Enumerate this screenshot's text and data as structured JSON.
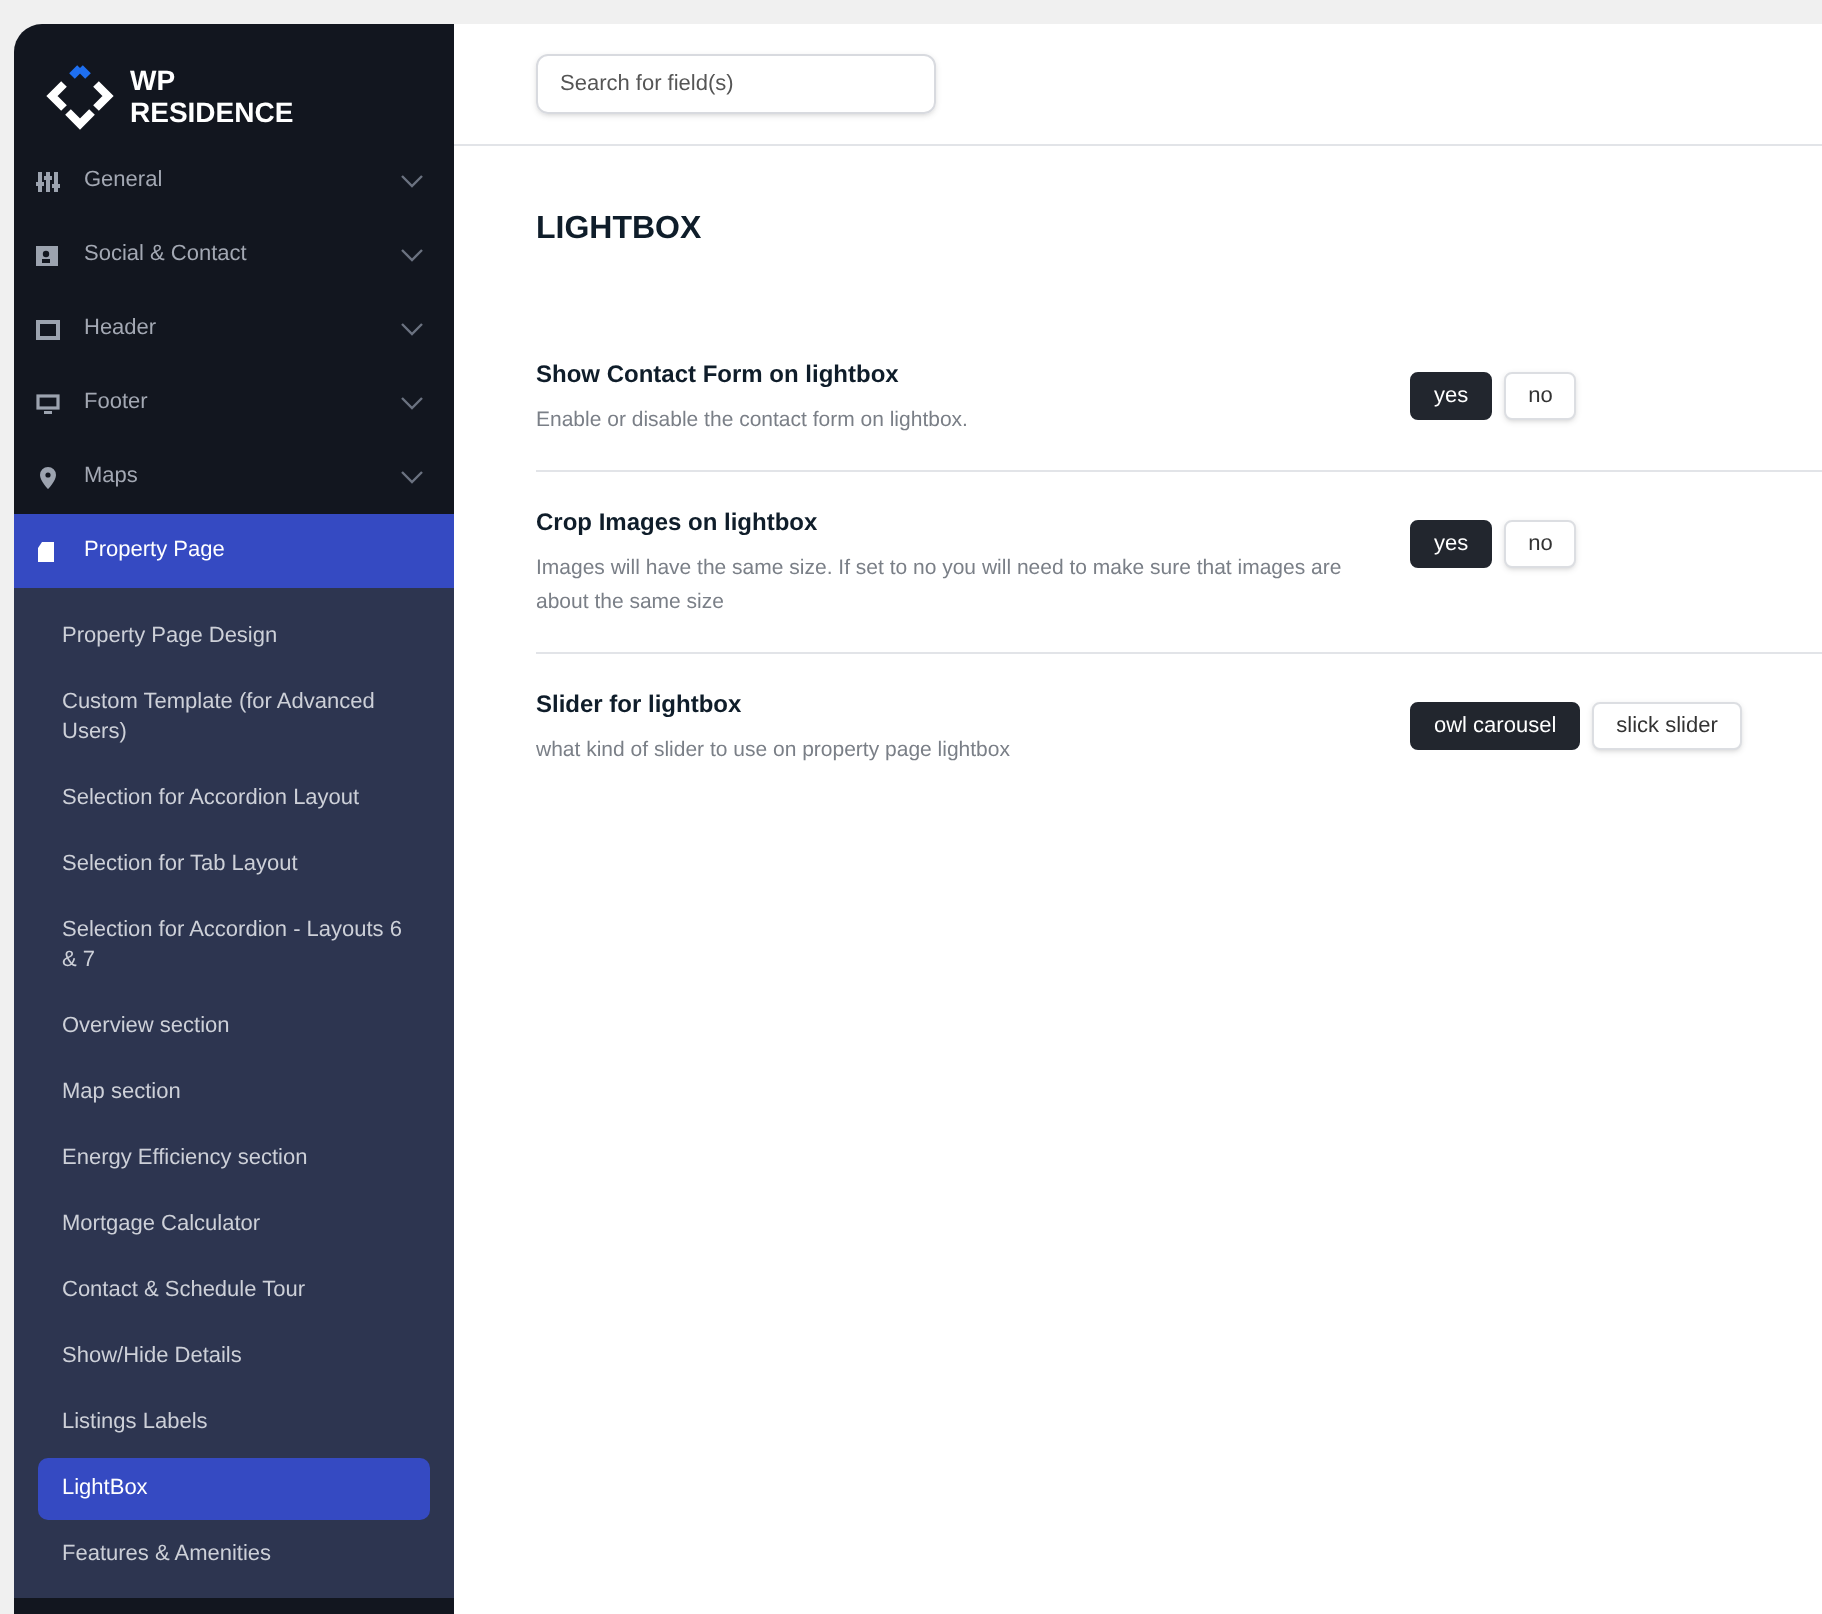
{
  "logo": {
    "lines": [
      "WP",
      "RESIDENCE"
    ]
  },
  "sidebar": {
    "items": [
      {
        "label": "General",
        "selected": false,
        "expanded": false
      },
      {
        "label": "Social & Contact",
        "selected": false,
        "expanded": false
      },
      {
        "label": "Header",
        "selected": false,
        "expanded": false
      },
      {
        "label": "Footer",
        "selected": false,
        "expanded": false
      },
      {
        "label": "Maps",
        "selected": false,
        "expanded": false
      },
      {
        "label": "Property Page",
        "selected": true,
        "expanded": true,
        "children": [
          {
            "label": "Property Page Design",
            "selected": false
          },
          {
            "label": "Custom Template (for Advanced Users)",
            "selected": false
          },
          {
            "label": "Selection for Accordion Layout",
            "selected": false
          },
          {
            "label": "Selection for Tab Layout",
            "selected": false
          },
          {
            "label": "Selection for Accordion - Layouts 6 & 7",
            "selected": false
          },
          {
            "label": "Overview section",
            "selected": false
          },
          {
            "label": "Map section",
            "selected": false
          },
          {
            "label": "Energy Efficiency section",
            "selected": false
          },
          {
            "label": "Mortgage Calculator",
            "selected": false
          },
          {
            "label": "Contact & Schedule Tour",
            "selected": false
          },
          {
            "label": "Show/Hide Details",
            "selected": false
          },
          {
            "label": "Listings Labels",
            "selected": false
          },
          {
            "label": "LightBox",
            "selected": true
          },
          {
            "label": "Features & Amenities",
            "selected": false
          }
        ]
      }
    ]
  },
  "search": {
    "placeholder": "Search for field(s)"
  },
  "section_title": "LIGHTBOX",
  "settings": [
    {
      "title": "Show Contact Form on lightbox",
      "description": "Enable or disable the contact form on lightbox.",
      "options": [
        {
          "label": "yes",
          "selected": true
        },
        {
          "label": "no",
          "selected": false
        }
      ]
    },
    {
      "title": "Crop Images on lightbox",
      "description": "Images will have the same size. If set to no you will need to make sure that images are about the same size",
      "options": [
        {
          "label": "yes",
          "selected": true
        },
        {
          "label": "no",
          "selected": false
        }
      ]
    },
    {
      "title": "Slider for lightbox",
      "description": "what kind of slider to use on property page lightbox",
      "options": [
        {
          "label": "owl carousel",
          "selected": true
        },
        {
          "label": "slick slider",
          "selected": false
        }
      ]
    }
  ]
}
